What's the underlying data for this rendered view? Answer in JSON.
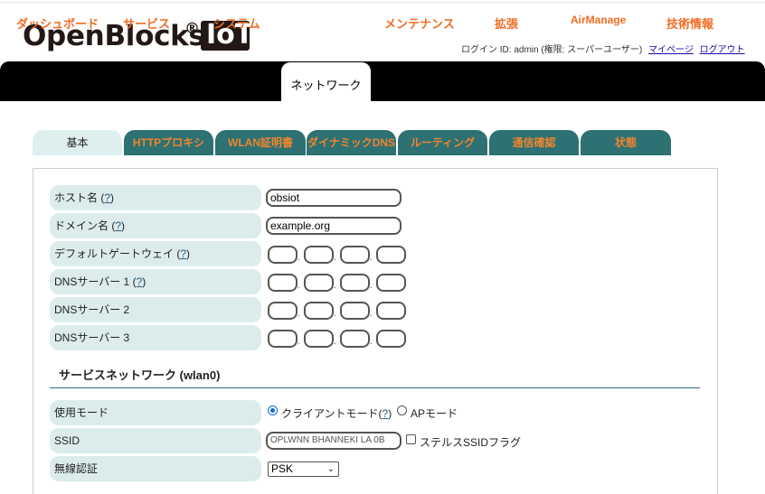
{
  "logo": {
    "text": "OpenBlocks",
    "reg": "®",
    "badge": "IoT"
  },
  "user": {
    "login_info": "ログイン ID: admin (権限: スーパーユーザー)",
    "mypage": "マイページ",
    "logout": "ログアウト"
  },
  "nav": {
    "items": [
      "ダッシュボード",
      "サービス",
      "システム",
      "ネットワーク",
      "メンテナンス",
      "拡張",
      "AirManage",
      "技術情報"
    ],
    "active": "ネットワーク"
  },
  "tabs": {
    "items": [
      "基本",
      "HTTPプロキシ",
      "WLAN証明書",
      "ダイナミックDNS",
      "ルーティング",
      "通信確認",
      "状態"
    ],
    "active": "基本"
  },
  "form": {
    "help": "?",
    "hostname": {
      "label": "ホスト名",
      "value": "obsiot"
    },
    "domain": {
      "label": "ドメイン名",
      "value": "example.org"
    },
    "gateway": {
      "label": "デフォルトゲートウェイ"
    },
    "dns1": {
      "label": "DNSサーバー 1"
    },
    "dns2": {
      "label": "DNSサーバー 2"
    },
    "dns3": {
      "label": "DNSサーバー 3"
    },
    "dot": "."
  },
  "wlan": {
    "section_title": "サービスネットワーク (wlan0)",
    "mode": {
      "label": "使用モード",
      "client": "クライアントモード",
      "ap": "APモード",
      "selected": "client"
    },
    "ssid": {
      "label": "SSID",
      "value": "OPLWNN BHANNEKI LA 0B",
      "stealth_label": "ステルスSSIDフラグ",
      "stealth_checked": false
    },
    "auth": {
      "label": "無線認証",
      "value": "PSK"
    }
  },
  "colors": {
    "nav_bg": "#000000",
    "nav_text": "#f26c22",
    "tab_bg": "#2d7173",
    "tab_text": "#f0852d",
    "label_bg": "#dcecec"
  }
}
